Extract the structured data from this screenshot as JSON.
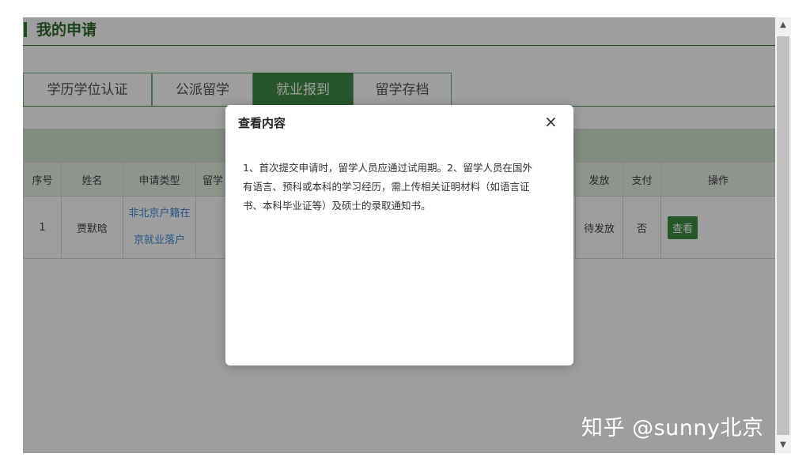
{
  "page_title": "我的申请",
  "tabs": [
    {
      "label": "学历学位认证",
      "active": false
    },
    {
      "label": "公派留学",
      "active": false
    },
    {
      "label": "就业报到",
      "active": true
    },
    {
      "label": "留学存档",
      "active": false
    }
  ],
  "table": {
    "headers": [
      "序号",
      "姓名",
      "申请类型",
      "留学",
      "发放",
      "支付",
      "操作"
    ],
    "rows": [
      {
        "index": "1",
        "name": "贾默晗",
        "type_line1": "非北京户籍在",
        "type_line2": "京就业落户",
        "issue_status": "待发放",
        "paid": "否",
        "action_label": "查看"
      }
    ]
  },
  "modal": {
    "title": "查看内容",
    "close_glyph": "×",
    "lines": [
      "1、首次提交申请时，留学人员应通过试用期。2、留学人员在国外",
      "有语言、预科或本科的学习经历，需上传相关证明材料（如语言证",
      "书、本科毕业证等）及硕士的录取通知书。"
    ]
  },
  "watermark": "知乎 @sunny北京",
  "colors": {
    "brand_green": "#3e8b45",
    "title_green": "#2f6b2f",
    "link_blue": "#3a8bd8",
    "overlay": "rgba(0,0,0,0.38)"
  }
}
